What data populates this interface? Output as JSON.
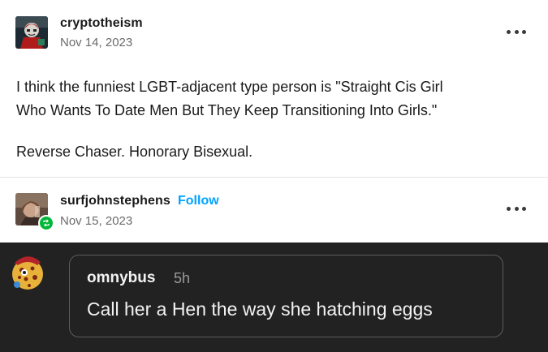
{
  "post": {
    "author": "cryptotheism",
    "date": "Nov 14, 2023",
    "lines": [
      "I think the funniest LGBT-adjacent type person is \"Straight Cis Girl",
      "Who Wants To Date Men But They Keep Transitioning Into Girls.\"",
      "Reverse Chaser. Honorary Bisexual."
    ]
  },
  "reblog": {
    "author": "surfjohnstephens",
    "follow_label": "Follow",
    "date": "Nov 15, 2023"
  },
  "comment": {
    "author": "omnybus",
    "time": "5h",
    "text": "Call her a Hen the way she hatching eggs"
  },
  "icons": {
    "more": "more-options-icon",
    "reblog": "reblog-icon"
  },
  "colors": {
    "follow": "#00a3ff",
    "reblog_badge": "#00b837",
    "dark_bg": "#222222"
  }
}
